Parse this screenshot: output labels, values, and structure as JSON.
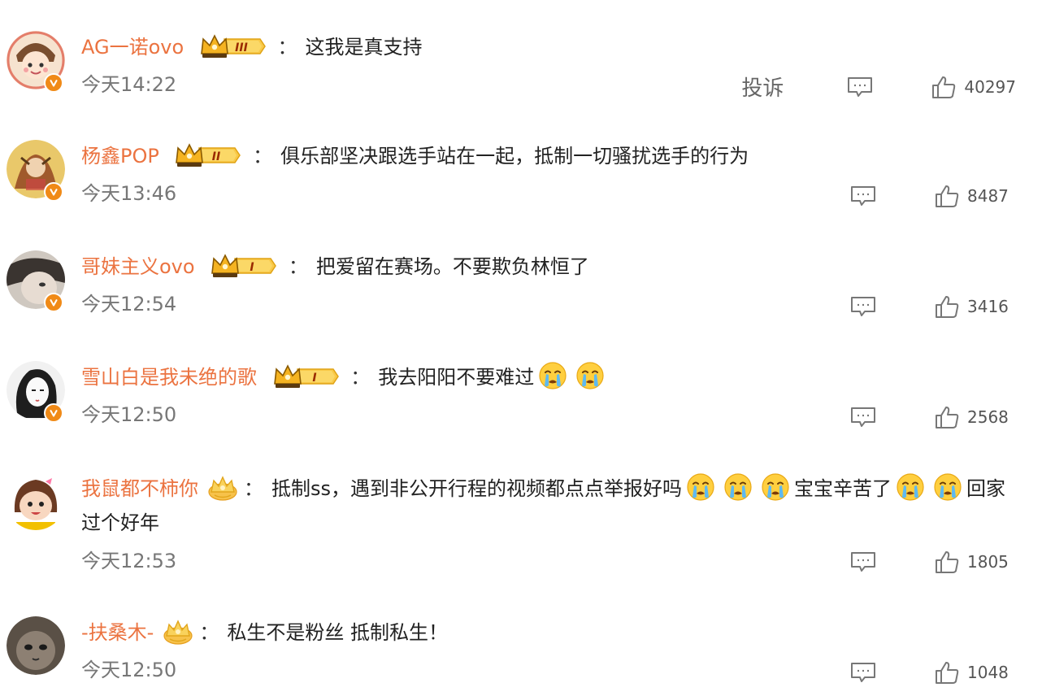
{
  "comments": [
    {
      "username": "AG一诺ovo",
      "badge_level": "III",
      "colon": "：",
      "text": "这我是真支持",
      "time": "今天14:22",
      "report_label": "投诉",
      "likes": "40297"
    },
    {
      "username": "杨鑫POP",
      "badge_level": "II",
      "colon": "：",
      "text": "俱乐部坚决跟选手站在一起，抵制一切骚扰选手的行为",
      "time": "今天13:46",
      "likes": "8487"
    },
    {
      "username": "哥妹主义ovo",
      "badge_level": "I",
      "colon": "：",
      "text": "把爱留在赛场。不要欺负林恒了",
      "time": "今天12:54",
      "likes": "3416"
    },
    {
      "username": "雪山白是我未绝的歌",
      "badge_level": "I",
      "colon": "：",
      "text": "我去阳阳不要难过",
      "time": "今天12:50",
      "likes": "2568"
    },
    {
      "username": "我鼠都不柿你",
      "colon": "：",
      "text_part1": "抵制ss，遇到非公开行程的视频都点点举报好吗",
      "text_part2": "宝宝辛苦了",
      "text_part3": "回家过个好年",
      "time": "今天12:53",
      "likes": "1805"
    },
    {
      "username": "-扶桑木-",
      "colon": "：",
      "text": "私生不是粉丝 抵制私生！",
      "time": "今天12:50",
      "likes": "1048"
    }
  ],
  "colors": {
    "username": "#eb7340",
    "verified_badge": "#f08a17",
    "crown_gold": "#f5b321"
  }
}
